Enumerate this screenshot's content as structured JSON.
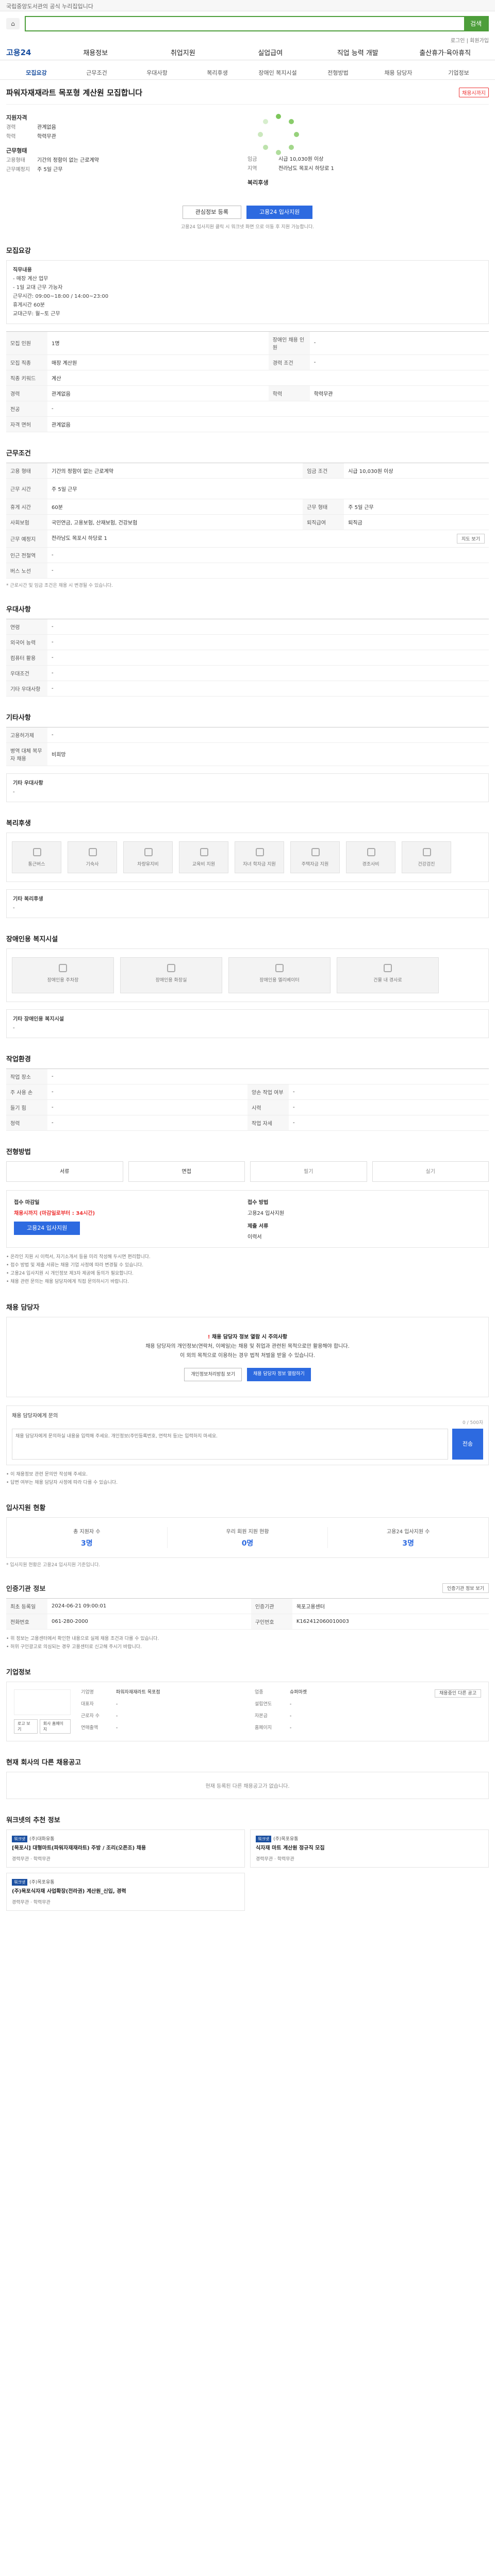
{
  "notice_bar": "국립중앙도서관의 공식 누리집입니다",
  "top": {
    "search_placeholder": "",
    "search_btn": "검색",
    "util": "로그인 | 회원가입"
  },
  "gnb": {
    "logo": "고용24",
    "items": [
      "채용정보",
      "취업지원",
      "실업급여",
      "직업 능력 개발",
      "출산휴가·육아휴직"
    ]
  },
  "sub_tabs": [
    "모집요강",
    "근무조건",
    "우대사항",
    "복리후생",
    "장애인 복지시설",
    "전형방법",
    "채용 담당자",
    "기업정보"
  ],
  "job": {
    "title": "파워자재재라트 목포형 계산원 모집합니다",
    "badge": "채용시까지",
    "summary_left_head": "지원자격",
    "summary_left_rows": [
      {
        "k": "경력",
        "v": "관계없음"
      },
      {
        "k": "학력",
        "v": "학력무관"
      }
    ],
    "summary_left_head2": "근무형태",
    "summary_left_rows2": [
      {
        "k": "고용형태",
        "v": "기간의 정함이 없는 근로계약"
      },
      {
        "k": "근무예정지",
        "v": "주 5일 근무"
      }
    ],
    "summary_right_rows": [
      {
        "k": "임금",
        "v": "시급 10,030원 이상"
      },
      {
        "k": "지역",
        "v": "전라남도 목포시 하당로 1"
      }
    ],
    "summary_right_head": "복리후생"
  },
  "actions": {
    "scrap": "관심정보 등록",
    "apply": "고용24 입사지원"
  },
  "apply_notice": "고용24 입사지원 클릭 시 워크넷 화면 으로 이동 후 지원 가능합니다.",
  "sections": {
    "recruit": "모집요강",
    "work": "근무조건",
    "pref": "우대사항",
    "other": "기타사항",
    "welfare": "복리후생",
    "disabled": "장애인용 복지시설",
    "env": "작업환경",
    "process": "전형방법",
    "contact": "채용 담당자",
    "stats": "입사지원 현황",
    "manage": "인증기관 정보",
    "company": "기업정보",
    "other_jobs": "현재 회사의 다른 채용공고",
    "recommend": "워크넷의 추천 정보"
  },
  "recruit": {
    "duty_label": "직무내용",
    "duty_lines": [
      "- 매장 계산 업무",
      "- 1일 교대 근무 가능자",
      "근무시간: 09:00~18:00 / 14:00~23:00",
      "휴게시간 60분",
      "교대근무: 월~토 근무"
    ],
    "table": [
      {
        "k": "모집 인원",
        "v": "1명",
        "k2": "장애인 채용 인원",
        "v2": "-"
      },
      {
        "k": "모집 직종",
        "v": "매장 계산원",
        "k2": "경력 조건",
        "v2": "-"
      },
      {
        "k": "직종 키워드",
        "v": "계산",
        "k2": "",
        "v2": ""
      },
      {
        "k": "경력",
        "v": "관계없음",
        "k2": "학력",
        "v2": "학력무관"
      },
      {
        "k": "전공",
        "v": "-",
        "k2": "",
        "v2": ""
      },
      {
        "k": "자격 면허",
        "v": "관계없음",
        "k2": "",
        "v2": ""
      }
    ]
  },
  "work": {
    "table": [
      {
        "k": "고용 형태",
        "v": "기간의 정함이 없는 근로계약",
        "k2": "임금 조건",
        "v2": "시급 10,030원 이상"
      },
      {
        "k": "근무 시간",
        "v": "주 5일 근무",
        "k2": "",
        "v2": ""
      },
      {
        "k": "휴게 시간",
        "v": "60분",
        "k2": "근무 형태",
        "v2": "주 5일 근무"
      },
      {
        "k": "사회보험",
        "v": "국민연금, 고용보험, 산재보험, 건강보험",
        "k2": "퇴직급여",
        "v2": "퇴직금"
      },
      {
        "k": "근무 예정지",
        "v": "전라남도 목포시 하당로 1",
        "k2": "",
        "v2": ""
      },
      {
        "k": "인근 전철역",
        "v": "-",
        "k2": "",
        "v2": ""
      },
      {
        "k": "버스 노선",
        "v": "-",
        "k2": "",
        "v2": ""
      }
    ],
    "map_btn": "지도 보기",
    "note": "* 근로시간 및 임금 조건은 채용 시 변경될 수 있습니다."
  },
  "pref": {
    "table": [
      {
        "k": "연령",
        "v": "-"
      },
      {
        "k": "외국어 능력",
        "v": "-"
      },
      {
        "k": "컴퓨터 활용",
        "v": "-"
      },
      {
        "k": "우대조건",
        "v": "-"
      },
      {
        "k": "기타 우대사항",
        "v": "-"
      }
    ]
  },
  "other": {
    "table": [
      {
        "k": "고용허가제",
        "v": "-"
      },
      {
        "k": "병역 대체 복무자 채용",
        "v": "비희망"
      }
    ],
    "sub": "기타 우대사항",
    "sub_v": "-"
  },
  "welfare": {
    "icons": [
      "통근버스",
      "기숙사",
      "차량유지비",
      "교육비 지원",
      "자녀 학자금 지원",
      "주택자금 지원",
      "경조사비",
      "건강검진"
    ],
    "sub": "기타 복리후생",
    "sub_v": "-"
  },
  "disabled": {
    "icons": [
      "장애인용 주차장",
      "장애인용 화장실",
      "장애인용 엘리베이터",
      "건물 내 경사로"
    ],
    "sub": "기타 장애인용 복지시설",
    "sub_v": "-"
  },
  "env": {
    "table": [
      {
        "k": "작업 장소",
        "v": "-",
        "k2": "",
        "v2": ""
      },
      {
        "k": "주 사용 손",
        "v": "-",
        "k2": "양손 작업 여부",
        "v2": "-"
      },
      {
        "k": "들기 힘",
        "v": "-",
        "k2": "시력",
        "v2": "-"
      },
      {
        "k": "청력",
        "v": "-",
        "k2": "작업 자세",
        "v2": "-"
      }
    ]
  },
  "process": {
    "steps": [
      "서류",
      "면접",
      "필기",
      "실기"
    ],
    "apply_head": "접수 마감일",
    "apply_val": "채용시까지 (마감일로부터 : 34시간)",
    "apply_btn": "고용24 입사지원",
    "method_head": "접수 방법",
    "method_val": "고용24 입사지원",
    "doc_head": "제출 서류",
    "doc_val": "이력서",
    "bullets": [
      "• 온라인 지원 시 이력서, 자기소개서 등을 미리 작성해 두시면 편리합니다.",
      "• 접수 방법 및 제출 서류는 채용 기업 사정에 따라 변경될 수 있습니다.",
      "• 고용24 입사지원 시 개인정보 제3자 제공에 동의가 필요합니다.",
      "• 채용 관련 문의는 채용 담당자에게 직접 문의하시기 바랍니다."
    ]
  },
  "contact": {
    "warn_mark": "!",
    "warn": "채용 담당자 정보 열람 시 주의사항",
    "desc1": "채용 담당자의 개인정보(연락처, 이메일)는 채용 및 취업과 관련된 목적으로만 활용해야 합니다.",
    "desc2": "이 외의 목적으로 이용하는 경우 법적 처벌을 받을 수 있습니다.",
    "btn_a": "개인정보처리방침 보기",
    "btn_b": "채용 담당자 정보 열람하기",
    "inquiry_label": "채용 담당자에게 문의",
    "inquiry_placeholder": "채용 담당자에게 문의하실 내용을 입력해 주세요. 개인정보(주민등록번호, 연락처 등)는 입력하지 마세요.",
    "inquiry_btn": "전송",
    "count": "0 / 500자",
    "inquiry_notes": [
      "• 이 채용정보 관련 문의만 작성해 주세요.",
      "• 답변 여부는 채용 담당자 사정에 따라 다를 수 있습니다."
    ]
  },
  "stats": {
    "items": [
      {
        "label": "총 지원자 수",
        "value": "3명"
      },
      {
        "label": "우리 회원 지원 현황",
        "value": "0명"
      },
      {
        "label": "고용24 입사지원 수",
        "value": "3명"
      }
    ],
    "note": "* 입사지원 현황은 고용24 입사지원 기준입니다."
  },
  "manage": {
    "btn": "인증기관 정보 보기",
    "table": [
      {
        "k": "최초 등록일",
        "v": "2024-06-21 09:00:01",
        "k2": "인증기관",
        "v2": "목포고용센터"
      },
      {
        "k": "전화번호",
        "v": "061-280-2000",
        "k2": "구인번호",
        "v2": "K162412060010003"
      }
    ],
    "notes": [
      "• 위 정보는 고용센터에서 확인한 내용으로 실제 채용 조건과 다를 수 있습니다.",
      "• 허위 구인광고로 의심되는 경우 고용센터로 신고해 주시기 바랍니다."
    ]
  },
  "company": {
    "btn_a": "로고 보기",
    "btn_b": "회사 홈페이지",
    "info": [
      {
        "k": "기업명",
        "v": "파워자재재라트 목포점"
      },
      {
        "k": "업종",
        "v": "슈퍼마켓"
      },
      {
        "k": "대표자",
        "v": "-"
      },
      {
        "k": "설립연도",
        "v": "-"
      },
      {
        "k": "근로자 수",
        "v": "-"
      },
      {
        "k": "자본금",
        "v": "-"
      },
      {
        "k": "연매출액",
        "v": "-"
      },
      {
        "k": "홈페이지",
        "v": "-"
      }
    ],
    "more_btn": "채용중인 다른 공고"
  },
  "other_jobs": {
    "empty": "현재 등록된 다른 채용공고가 없습니다."
  },
  "recommend": {
    "cards": [
      {
        "tag": "워크넷",
        "comp": "(주)대화유통",
        "title": "[목포시] 대형마트(파워자재재라트) 주방 / 조리(오픈조) 채용",
        "meta": "경력무관 · 학력무관"
      },
      {
        "tag": "워크넷",
        "comp": "(주)목포유통",
        "title": "식자재 마트 계산원 정규직 모집",
        "meta": "경력무관 · 학력무관"
      },
      {
        "tag": "워크넷",
        "comp": "(주)목포유통",
        "title": "(주)목포식자재 사업확장(전라권) 계산원_신입, 경력",
        "meta": "경력무관 · 학력무관"
      }
    ]
  }
}
